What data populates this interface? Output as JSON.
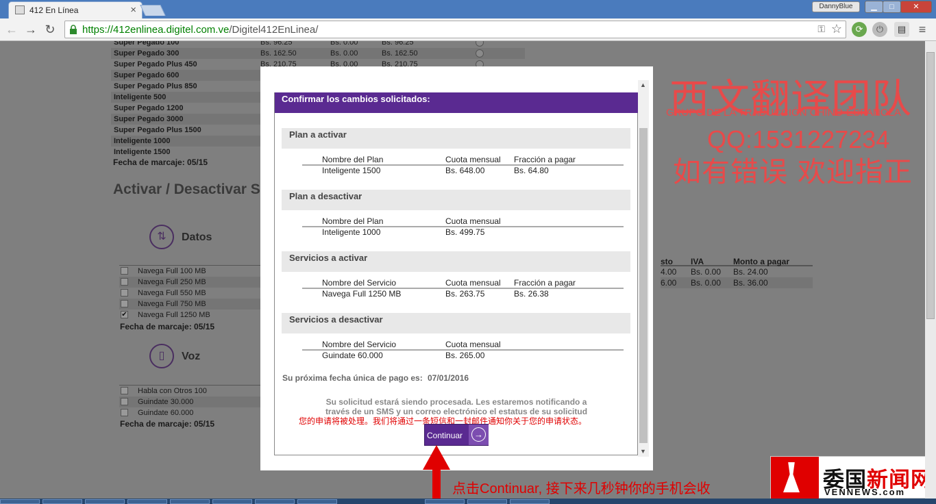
{
  "browser": {
    "tab_title": "412 En Línea",
    "tab_close": "×",
    "profile_name": "DannyBlue",
    "window_controls": {
      "minimize": "▁",
      "maximize": "□",
      "close": "✕"
    },
    "nav": {
      "back": "←",
      "forward": "→",
      "reload": "↻"
    },
    "url_scheme_host": "https://412enlinea.digitel.com.ve",
    "url_path": "/Digitel412EnLinea/",
    "menu_glyph": "≡"
  },
  "plans": {
    "rows": [
      {
        "name": "Super Pegado 100",
        "c1": "Bs.   96.25",
        "c2": "Bs. 0.00",
        "c3": "Bs.   96.25"
      },
      {
        "name": "Super Pegado 300",
        "c1": "Bs.  162.50",
        "c2": "Bs. 0.00",
        "c3": "Bs.  162.50"
      },
      {
        "name": "Super Pegado Plus 450",
        "c1": "Bs.  210.75",
        "c2": "Bs. 0.00",
        "c3": "Bs.  210.75"
      },
      {
        "name": "Super Pegado 600",
        "c1": "",
        "c2": "",
        "c3": ""
      },
      {
        "name": "Super Pegado Plus 850",
        "c1": "",
        "c2": "",
        "c3": ""
      },
      {
        "name": "Inteligente 500",
        "c1": "",
        "c2": "",
        "c3": ""
      },
      {
        "name": "Super Pegado 1200",
        "c1": "",
        "c2": "",
        "c3": ""
      },
      {
        "name": "Super Pegado 3000",
        "c1": "",
        "c2": "",
        "c3": ""
      },
      {
        "name": "Super Pegado Plus 1500",
        "c1": "",
        "c2": "",
        "c3": ""
      },
      {
        "name": "Inteligente 1000",
        "c1": "",
        "c2": "",
        "c3": ""
      },
      {
        "name": "Inteligente 1500",
        "c1": "",
        "c2": "",
        "c3": ""
      }
    ],
    "fecha": "Fecha de marcaje: 05/15"
  },
  "section_title": "Activar / Desactivar S",
  "datos": {
    "label": "Datos",
    "items": [
      {
        "label": "Navega Full 100 MB",
        "checked": ""
      },
      {
        "label": "Navega Full 250 MB",
        "checked": ""
      },
      {
        "label": "Navega Full 550 MB",
        "checked": ""
      },
      {
        "label": "Navega Full 750 MB",
        "checked": ""
      },
      {
        "label": "Navega Full 1250 MB",
        "checked": "✔"
      }
    ],
    "fecha": "Fecha de marcaje: 05/15"
  },
  "voz": {
    "label": "Voz",
    "items": [
      {
        "label": "Habla con Otros 100"
      },
      {
        "label": "Guindate 30.000"
      },
      {
        "label": "Guindate 60.000"
      }
    ],
    "fecha": "Fecha de marcaje: 05/15"
  },
  "right_table": {
    "headers": {
      "costo": "sto",
      "iva": "IVA",
      "monto": "Monto a pagar"
    },
    "rows": [
      {
        "costo": "4.00",
        "iva": "Bs. 0.00",
        "monto": "Bs.   24.00"
      },
      {
        "costo": "6.00",
        "iva": "Bs. 0.00",
        "monto": "Bs.   36.00"
      }
    ]
  },
  "modal": {
    "title": "Confirmar los cambios solicitados:",
    "plan_activar": {
      "heading": "Plan a activar",
      "h1": "Nombre del Plan",
      "h2": "Cuota mensual",
      "h3": "Fracción a pagar",
      "v1": "Inteligente 1500",
      "v2": "Bs.   648.00",
      "v3": "Bs.    64.80"
    },
    "plan_desactivar": {
      "heading": "Plan a desactivar",
      "h1": "Nombre del Plan",
      "h2": "Cuota mensual",
      "v1": "Inteligente 1000",
      "v2": "Bs.   499.75"
    },
    "servicios_activar": {
      "heading": "Servicios a activar",
      "h1": "Nombre del Servicio",
      "h2": "Cuota mensual",
      "h3": "Fracción a pagar",
      "v1": "Navega Full 1250 MB",
      "v2": "Bs.   263.75",
      "v3": "Bs.    26.38"
    },
    "servicios_desactivar": {
      "heading": "Servicios a desactivar",
      "h1": "Nombre del Servicio",
      "h2": "Cuota mensual",
      "v1": "Guindate 60.000",
      "v2": "Bs.   265.00"
    },
    "next_payment_label": "Su próxima fecha única de pago es:",
    "next_payment_date": "07/01/2016",
    "notice": "Su solicitud estará siendo procesada. Les estaremos notificando a través de un SMS y un correo electrónico el estatus de su solicitud",
    "notice_cn": "您的申请将被处理。我们将通过一条短信和一封邮件通知你关于您的申请状态。",
    "continue_label": "Continuar",
    "continue_arrow": "→",
    "scroll_up": "▲",
    "scroll_down": "▼"
  },
  "watermark": {
    "zh_team": "西文翻译团队",
    "es_team": "GRUPO DE LA TRADUCCIÓN CHINO-ESPAÑOLA",
    "qq": "QQ:1531227234",
    "errors": "如有错误  欢迎指正"
  },
  "instruction": "点击Continuar, 接下来几秒钟你的手机会收",
  "logo": {
    "zh_a": "委国",
    "zh_b": "新闻网",
    "en": "VENNEWS.com"
  },
  "colors": {
    "brand_purple": "#5a2a91",
    "annotation_red": "#e00000",
    "watermark_red": "#e84a4a"
  }
}
